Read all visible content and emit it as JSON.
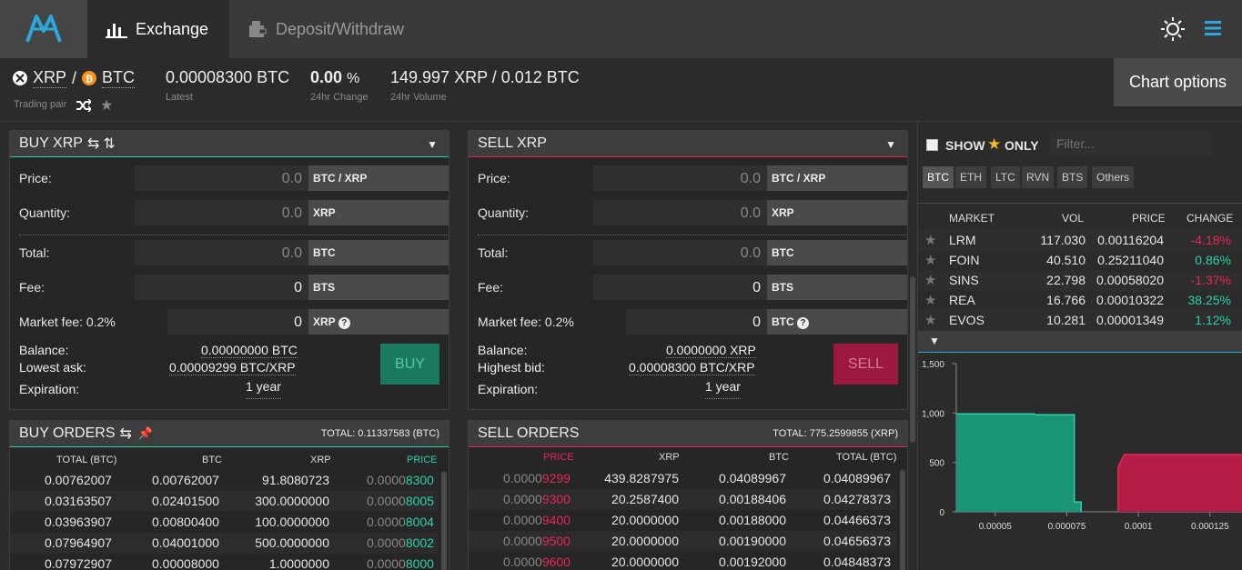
{
  "nav": {
    "exchange": "Exchange",
    "deposit": "Deposit/Withdraw"
  },
  "pair": {
    "quote": "XRP",
    "sep": "/",
    "base": "BTC",
    "label": "Trading pair"
  },
  "stats": {
    "latest": "0.00008300 BTC",
    "latest_label": "Latest",
    "change_num": "0.00",
    "change_pct": "%",
    "change_label": "24hr Change",
    "volume": "149.997 XRP / 0.012 BTC",
    "volume_label": "24hr Volume"
  },
  "chart_options": "Chart options",
  "buy": {
    "title": "BUY XRP",
    "price_label": "Price:",
    "price_val": "0.0",
    "price_unit": "BTC / XRP",
    "qty_label": "Quantity:",
    "qty_val": "0.0",
    "qty_unit": "XRP",
    "total_label": "Total:",
    "total_val": "0.0",
    "total_unit": "BTC",
    "fee_label": "Fee:",
    "fee_val": "0",
    "fee_unit": "BTS",
    "mfee_label": "Market fee: 0.2%",
    "mfee_val": "0",
    "mfee_unit": "XRP",
    "balance_label": "Balance:",
    "balance_val": "0.00000000 BTC",
    "ask_label": "Lowest ask:",
    "ask_val": "0.00009299 BTC/XRP",
    "exp_label": "Expiration:",
    "exp_val": "1 year",
    "button": "BUY"
  },
  "sell": {
    "title": "SELL XRP",
    "price_label": "Price:",
    "price_val": "0.0",
    "price_unit": "BTC / XRP",
    "qty_label": "Quantity:",
    "qty_val": "0.0",
    "qty_unit": "XRP",
    "total_label": "Total:",
    "total_val": "0.0",
    "total_unit": "BTC",
    "fee_label": "Fee:",
    "fee_val": "0",
    "fee_unit": "BTS",
    "mfee_label": "Market fee: 0.2%",
    "mfee_val": "0",
    "mfee_unit": "BTC",
    "balance_label": "Balance:",
    "balance_val": "0.0000000 XRP",
    "bid_label": "Highest bid:",
    "bid_val": "0.00008300 BTC/XRP",
    "exp_label": "Expiration:",
    "exp_val": "1 year",
    "button": "SELL"
  },
  "buy_orders": {
    "title": "BUY ORDERS",
    "total": "TOTAL: 0.11337583 (BTC)",
    "headers": [
      "TOTAL (BTC)",
      "BTC",
      "XRP",
      "PRICE"
    ],
    "rows": [
      {
        "total": "0.00762007",
        "btc": "0.00762007",
        "xrp": "91.8080723",
        "price_dim": "0.0000",
        "price_hi": "8300"
      },
      {
        "total": "0.03163507",
        "btc": "0.02401500",
        "xrp": "300.0000000",
        "price_dim": "0.0000",
        "price_hi": "8005"
      },
      {
        "total": "0.03963907",
        "btc": "0.00800400",
        "xrp": "100.0000000",
        "price_dim": "0.0000",
        "price_hi": "8004"
      },
      {
        "total": "0.07964907",
        "btc": "0.04001000",
        "xrp": "500.0000000",
        "price_dim": "0.0000",
        "price_hi": "8002"
      },
      {
        "total": "0.07972907",
        "btc": "0.00008000",
        "xrp": "1.0000000",
        "price_dim": "0.0000",
        "price_hi": "8000"
      }
    ]
  },
  "sell_orders": {
    "title": "SELL ORDERS",
    "total": "TOTAL: 775.2599855 (XRP)",
    "headers": [
      "PRICE",
      "XRP",
      "BTC",
      "TOTAL (BTC)"
    ],
    "rows": [
      {
        "price_dim": "0.0000",
        "price_hi": "9299",
        "xrp": "439.8287975",
        "btc": "0.04089967",
        "total": "0.04089967"
      },
      {
        "price_dim": "0.0000",
        "price_hi": "9300",
        "xrp": "20.2587400",
        "btc": "0.00188406",
        "total": "0.04278373"
      },
      {
        "price_dim": "0.0000",
        "price_hi": "9400",
        "xrp": "20.0000000",
        "btc": "0.00188000",
        "total": "0.04466373"
      },
      {
        "price_dim": "0.0000",
        "price_hi": "9500",
        "xrp": "20.0000000",
        "btc": "0.00190000",
        "total": "0.04656373"
      },
      {
        "price_dim": "0.0000",
        "price_hi": "9600",
        "xrp": "20.0000000",
        "btc": "0.00192000",
        "total": "0.04848373"
      }
    ]
  },
  "markets": {
    "show": "SHOW",
    "only": "ONLY",
    "filter_placeholder": "Filter...",
    "coins": [
      "BTC",
      "ETH",
      "LTC",
      "RVN",
      "BTS",
      "Others"
    ],
    "headers": [
      "MARKET",
      "VOL",
      "PRICE",
      "CHANGE"
    ],
    "rows": [
      {
        "name": "LRM",
        "vol": "117.030",
        "price": "0.00116204",
        "change": "-4.18%",
        "dir": "down"
      },
      {
        "name": "FOIN",
        "vol": "40.510",
        "price": "0.25211040",
        "change": "0.86%",
        "dir": "up"
      },
      {
        "name": "SINS",
        "vol": "22.798",
        "price": "0.00058020",
        "change": "-1.37%",
        "dir": "down"
      },
      {
        "name": "REA",
        "vol": "16.766",
        "price": "0.00010322",
        "change": "38.25%",
        "dir": "up"
      },
      {
        "name": "EVOS",
        "vol": "10.281",
        "price": "0.00001349",
        "change": "1.12%",
        "dir": "up"
      }
    ]
  },
  "chart_data": {
    "type": "area",
    "title": "",
    "xlabel": "",
    "ylabel": "",
    "x_ticks": [
      "0.00005",
      "0.000075",
      "0.0001",
      "0.000125"
    ],
    "y_ticks": [
      "0",
      "500",
      "1,000",
      "1,500"
    ],
    "xlim": [
      3.64e-05,
      0.0001365
    ],
    "ylim": [
      0,
      1500
    ],
    "series": [
      {
        "values": [
          [
            3.64e-05,
            992
          ],
          [
            6.36e-05,
            992
          ],
          [
            6.4e-05,
            982
          ],
          [
            7.76e-05,
            982
          ],
          [
            7.76e-05,
            100
          ],
          [
            8e-05,
            100
          ],
          [
            8e-05,
            0
          ]
        ],
        "color": "#1a9477"
      },
      {
        "values": [
          [
            9.29e-05,
            0
          ],
          [
            9.29e-05,
            440
          ],
          [
            9.3e-05,
            460
          ],
          [
            9.51e-05,
            580
          ],
          [
            0.0001365,
            580
          ]
        ],
        "color": "#b51c48"
      }
    ]
  },
  "colors": {
    "accent": "#29d3a9",
    "sell": "#e8265a",
    "buy_btn": "#1a7a60",
    "sell_btn": "#9b1840"
  }
}
